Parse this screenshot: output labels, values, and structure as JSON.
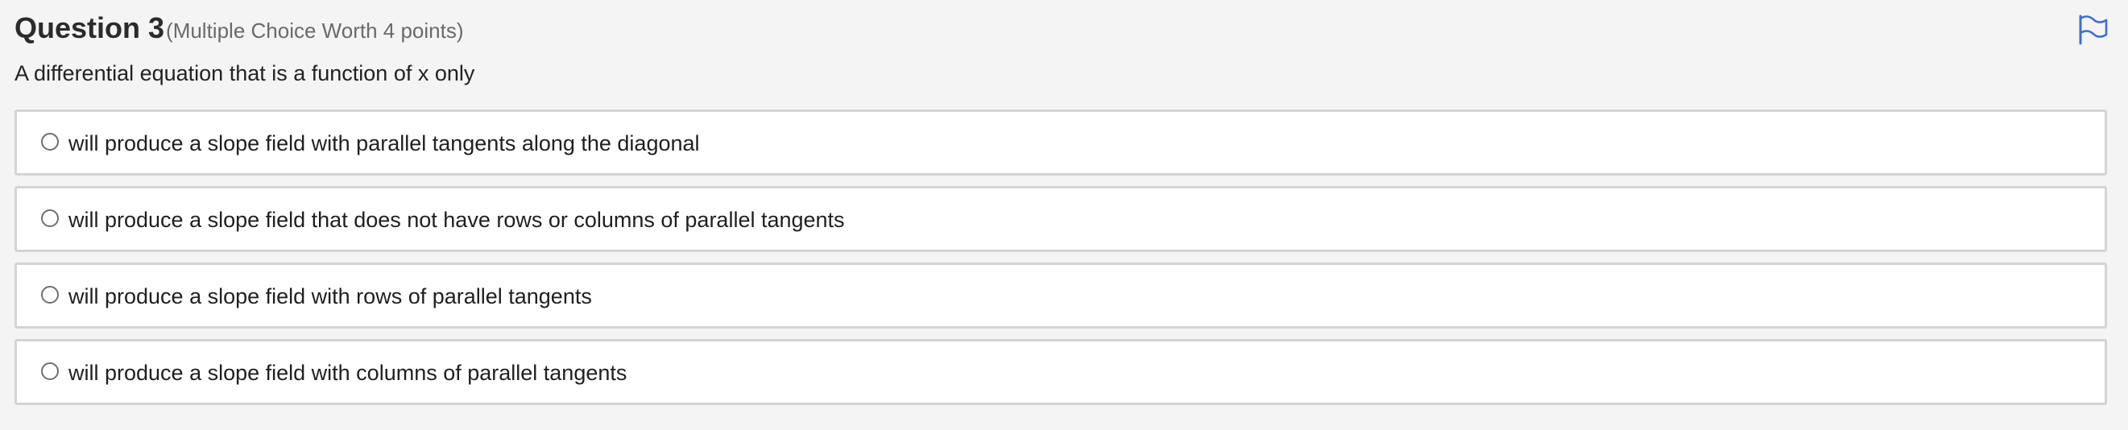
{
  "question": {
    "title": "Question 3",
    "meta": "(Multiple Choice Worth 4 points)",
    "prompt": "A differential equation that is a function of x only"
  },
  "flag": {
    "icon": "flag-icon",
    "color": "#3a6fd8"
  },
  "choices": [
    {
      "label": "will produce a slope field with parallel tangents along the diagonal",
      "selected": false
    },
    {
      "label": "will produce a slope field that does not have rows or columns of parallel tangents",
      "selected": false
    },
    {
      "label": "will produce a slope field with rows of parallel tangents",
      "selected": false
    },
    {
      "label": "will produce a slope field with columns of parallel tangents",
      "selected": false
    }
  ]
}
